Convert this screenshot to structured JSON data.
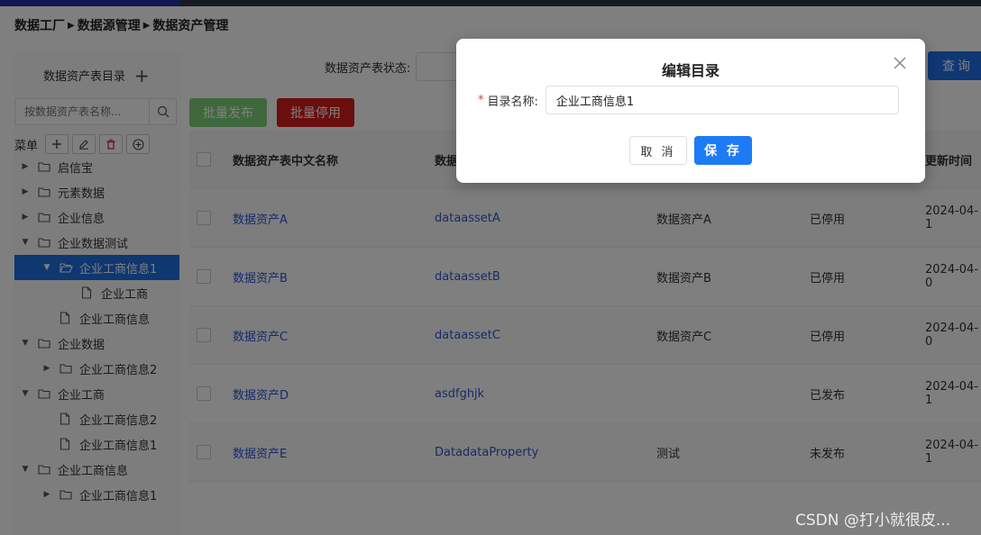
{
  "breadcrumb": [
    "数据工厂",
    "数据源管理",
    "数据资产管理"
  ],
  "sidebar": {
    "title": "数据资产表目录",
    "search_placeholder": "按数据资产表名称...",
    "menu_label": "菜单",
    "tree": [
      {
        "label": "启信宝",
        "level": 0,
        "expanded": false,
        "folder": true
      },
      {
        "label": "元素数据",
        "level": 0,
        "expanded": false,
        "folder": true
      },
      {
        "label": "企业信息",
        "level": 0,
        "expanded": false,
        "folder": true
      },
      {
        "label": "企业数据测试",
        "level": 0,
        "expanded": true,
        "folder": true
      },
      {
        "label": "企业工商信息1",
        "level": 1,
        "expanded": true,
        "folder": true,
        "selected": true
      },
      {
        "label": "企业工商",
        "level": 2,
        "folder": false
      },
      {
        "label": "企业工商信息",
        "level": 1,
        "folder": false
      },
      {
        "label": "企业数据",
        "level": 0,
        "expanded": true,
        "folder": true
      },
      {
        "label": "企业工商信息2",
        "level": 1,
        "expanded": false,
        "folder": true
      },
      {
        "label": "企业工商",
        "level": 0,
        "expanded": true,
        "folder": true
      },
      {
        "label": "企业工商信息2",
        "level": 1,
        "folder": false
      },
      {
        "label": "企业工商信息1",
        "level": 1,
        "folder": false
      },
      {
        "label": "企业工商信息",
        "level": 0,
        "expanded": true,
        "folder": true
      },
      {
        "label": "企业工商信息1",
        "level": 1,
        "expanded": false,
        "folder": true
      }
    ]
  },
  "search": {
    "status_label": "数据资产表状态:",
    "query_label": "查询"
  },
  "actions": {
    "publish_label": "批量发布",
    "stop_label": "批量停用"
  },
  "table": {
    "headers": [
      "数据资产表中文名称",
      "数据",
      "",
      "",
      "更新时间"
    ],
    "rows": [
      [
        "数据资产A",
        "dataassetA",
        "数据资产A",
        "已停用",
        "2024-04-1"
      ],
      [
        "数据资产B",
        "dataassetB",
        "数据资产B",
        "已停用",
        "2024-04-0"
      ],
      [
        "数据资产C",
        "dataassetC",
        "数据资产C",
        "已停用",
        "2024-04-0"
      ],
      [
        "数据资产D",
        "asdfghjk",
        "",
        "已发布",
        "2024-04-1"
      ],
      [
        "数据资产E",
        "DatadataProperty",
        "测试",
        "未发布",
        "2024-04-1"
      ]
    ]
  },
  "dialog": {
    "title": "编辑目录",
    "field_label": "目录名称:",
    "required_mark": "*",
    "field_value": "企业工商信息1",
    "cancel_label": "取 消",
    "save_label": "保 存"
  },
  "watermark": "CSDN @打小就很皮...",
  "colors": {
    "primary": "#1e6fe8",
    "danger": "#d41c1c",
    "success": "#7ed07a",
    "link": "#2f57d6"
  }
}
